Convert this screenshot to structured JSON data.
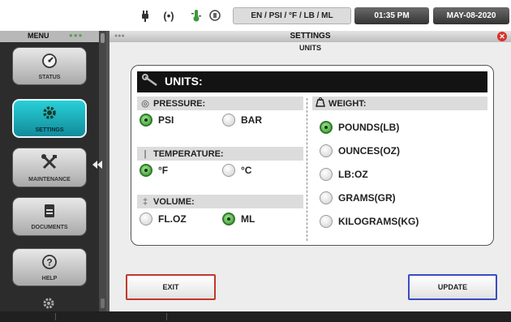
{
  "statusbar": {
    "units_summary": "EN / PSI / °F / LB / ML",
    "time": "01:35 PM",
    "date": "MAY-08-2020",
    "icons": [
      "power-plug-icon",
      "wireless-signal-icon",
      "thermometer-icon",
      "battery-icon"
    ]
  },
  "sidebar": {
    "menu_label": "MENU",
    "items": [
      {
        "label": "STATUS",
        "icon": "gauge-icon",
        "active": false
      },
      {
        "label": "SETTINGS",
        "icon": "gear-icon",
        "active": true
      },
      {
        "label": "MAINTENANCE",
        "icon": "tools-icon",
        "active": false
      },
      {
        "label": "DOCUMENTS",
        "icon": "document-icon",
        "active": false
      },
      {
        "label": "HELP",
        "icon": "question-icon",
        "active": false
      }
    ]
  },
  "window": {
    "title": "SETTINGS",
    "subtitle": "UNITS"
  },
  "panel": {
    "header": "UNITS:",
    "pressure": {
      "label": "PRESSURE:",
      "options": [
        {
          "label": "PSI",
          "selected": true
        },
        {
          "label": "BAR",
          "selected": false
        }
      ]
    },
    "temperature": {
      "label": "TEMPERATURE:",
      "options": [
        {
          "label": "°F",
          "selected": true
        },
        {
          "label": "°C",
          "selected": false
        }
      ]
    },
    "volume": {
      "label": "VOLUME:",
      "options": [
        {
          "label": "FL.OZ",
          "selected": false
        },
        {
          "label": "ML",
          "selected": true
        }
      ]
    },
    "weight": {
      "label": "WEIGHT:",
      "options": [
        {
          "label": "POUNDS(LB)",
          "selected": true
        },
        {
          "label": "OUNCES(OZ)",
          "selected": false
        },
        {
          "label": "LB:OZ",
          "selected": false
        },
        {
          "label": "GRAMS(GR)",
          "selected": false
        },
        {
          "label": "KILOGRAMS(KG)",
          "selected": false
        }
      ]
    }
  },
  "buttons": {
    "exit": "EXIT",
    "update": "UPDATE"
  },
  "colors": {
    "accent_active": "#1fb3c0",
    "selected_radio": "#3d9a35",
    "exit_border": "#c0392b",
    "update_border": "#3b4cc0",
    "close_button": "#d9302b"
  }
}
